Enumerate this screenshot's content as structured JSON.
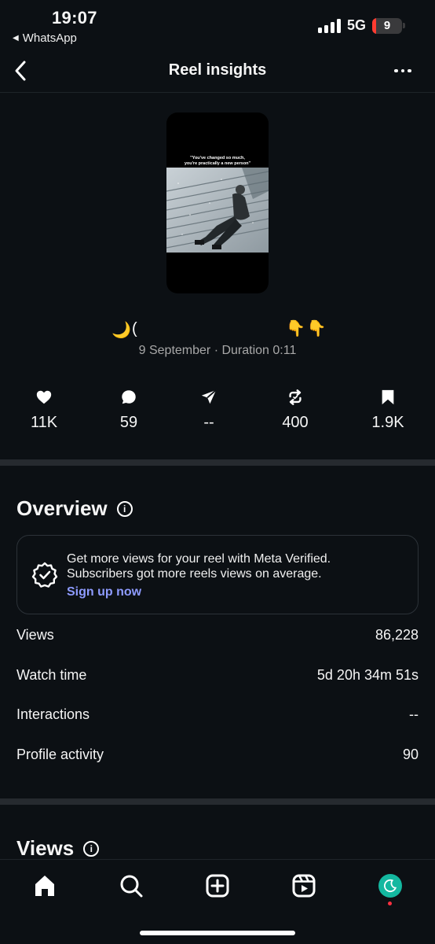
{
  "status_bar": {
    "time": "19:07",
    "back_app": "WhatsApp",
    "network": "5G",
    "battery": "9",
    "battery_color": "#ff3b30"
  },
  "header": {
    "title": "Reel insights",
    "back_icon": "chevron-left-icon",
    "more_icon": "more-horizontal-icon"
  },
  "reel": {
    "thumbnail_caption_line1": "\"You've changed so much,",
    "thumbnail_caption_line2": "you're practically a new person\"",
    "caption_start": "🌙",
    "caption_moon_partial": "(",
    "caption_end": "👇👇",
    "meta": "9 September · Duration 0:11"
  },
  "stats": [
    {
      "icon": "heart-icon",
      "value": "11K"
    },
    {
      "icon": "comment-icon",
      "value": "59"
    },
    {
      "icon": "send-icon",
      "value": "--"
    },
    {
      "icon": "repost-icon",
      "value": "400"
    },
    {
      "icon": "bookmark-icon",
      "value": "1.9K"
    }
  ],
  "overview": {
    "title": "Overview",
    "promo": {
      "line1": "Get more views for your reel with Meta Verified.",
      "line2": "Subscribers got more reels views on average.",
      "link": "Sign up now",
      "link_color": "#8e9bff"
    },
    "rows": [
      {
        "label": "Views",
        "value": "86,228"
      },
      {
        "label": "Watch time",
        "value": "5d 20h 34m 51s"
      },
      {
        "label": "Interactions",
        "value": "--"
      },
      {
        "label": "Profile activity",
        "value": "90"
      }
    ]
  },
  "views_section": {
    "title": "Views"
  },
  "bottom_nav": {
    "items": [
      "home-icon",
      "search-icon",
      "create-icon",
      "reels-icon",
      "profile-avatar"
    ],
    "accent": "#14b8a0"
  }
}
